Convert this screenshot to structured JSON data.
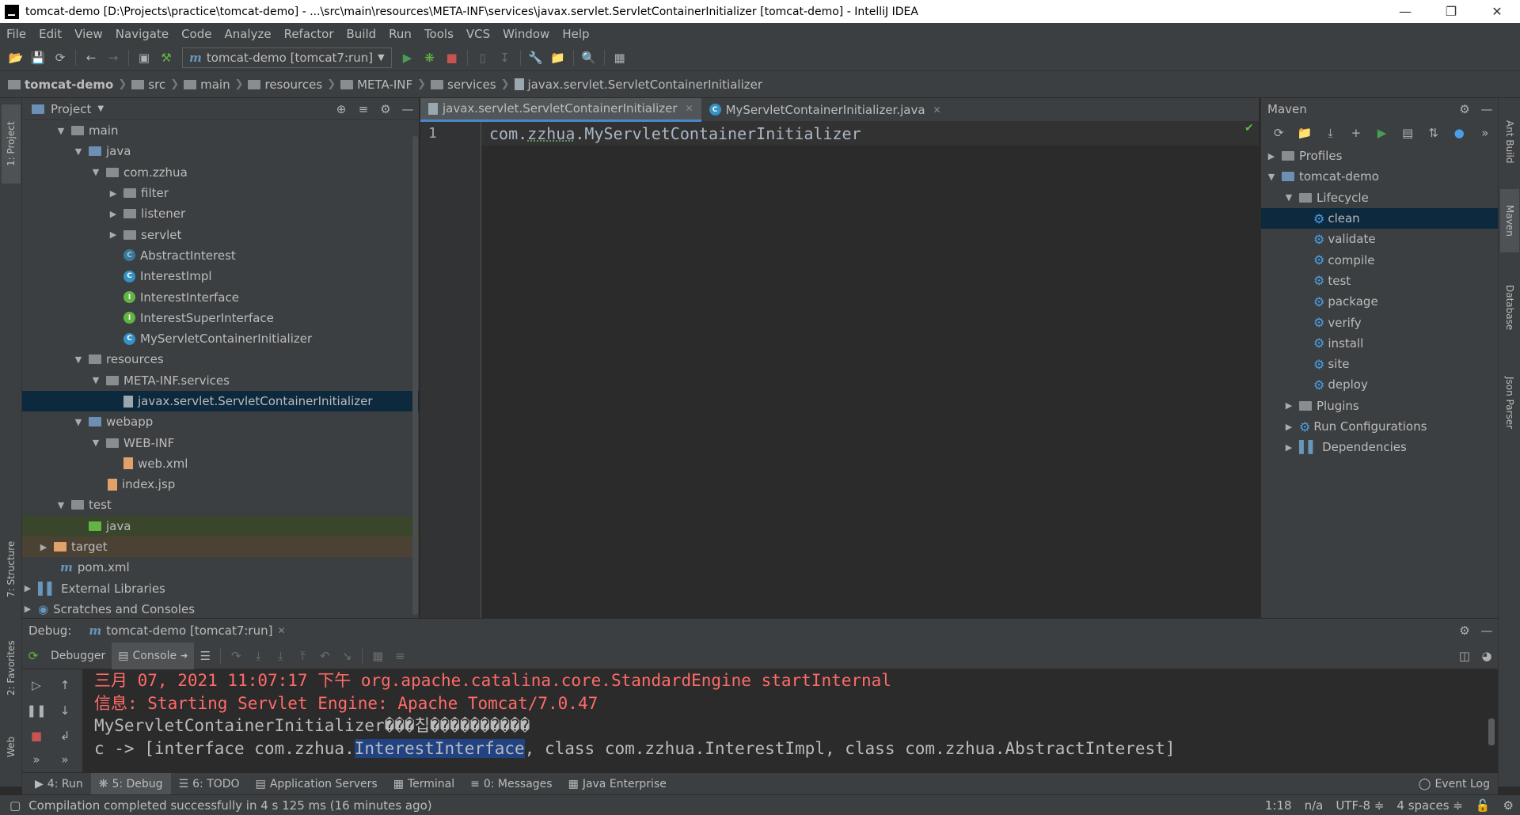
{
  "window": {
    "title": "tomcat-demo [D:\\Projects\\practice\\tomcat-demo] - ...\\src\\main\\resources\\META-INF\\services\\javax.servlet.ServletContainerInitializer [tomcat-demo] - IntelliJ IDEA"
  },
  "menu": [
    "File",
    "Edit",
    "View",
    "Navigate",
    "Code",
    "Analyze",
    "Refactor",
    "Build",
    "Run",
    "Tools",
    "VCS",
    "Window",
    "Help"
  ],
  "toolbar": {
    "run_config": "tomcat-demo [tomcat7:run]"
  },
  "breadcrumb": [
    "tomcat-demo",
    "src",
    "main",
    "resources",
    "META-INF",
    "services",
    "javax.servlet.ServletContainerInitializer"
  ],
  "left_strip": {
    "project": "1: Project",
    "structure": "7: Structure",
    "favorites": "2: Favorites",
    "web": "Web"
  },
  "right_strip": {
    "ant": "Ant Build",
    "maven": "Maven",
    "database": "Database",
    "json": "Json Parser"
  },
  "project": {
    "title": "Project",
    "tree": [
      {
        "label": "main"
      },
      {
        "label": "java"
      },
      {
        "label": "com.zzhua"
      },
      {
        "label": "filter"
      },
      {
        "label": "listener"
      },
      {
        "label": "servlet"
      },
      {
        "label": "AbstractInterest"
      },
      {
        "label": "InterestImpl"
      },
      {
        "label": "InterestInterface"
      },
      {
        "label": "InterestSuperInterface"
      },
      {
        "label": "MyServletContainerInitializer"
      },
      {
        "label": "resources"
      },
      {
        "label": "META-INF.services"
      },
      {
        "label": "javax.servlet.ServletContainerInitializer"
      },
      {
        "label": "webapp"
      },
      {
        "label": "WEB-INF"
      },
      {
        "label": "web.xml"
      },
      {
        "label": "index.jsp"
      },
      {
        "label": "test"
      },
      {
        "label": "java"
      },
      {
        "label": "target"
      },
      {
        "label": "pom.xml"
      },
      {
        "label": "External Libraries"
      },
      {
        "label": "Scratches and Consoles"
      }
    ]
  },
  "editor": {
    "tabs": [
      {
        "label": "javax.servlet.ServletContainerInitializer"
      },
      {
        "label": "MyServletContainerInitializer.java"
      }
    ],
    "line_number": "1",
    "code_pkg1": "com.",
    "code_pkg2": "zzhua",
    "code_rest": ".MyServletContainerInitializer"
  },
  "maven": {
    "title": "Maven",
    "tree": [
      {
        "label": "Profiles"
      },
      {
        "label": "tomcat-demo"
      },
      {
        "label": "Lifecycle"
      },
      {
        "label": "clean"
      },
      {
        "label": "validate"
      },
      {
        "label": "compile"
      },
      {
        "label": "test"
      },
      {
        "label": "package"
      },
      {
        "label": "verify"
      },
      {
        "label": "install"
      },
      {
        "label": "site"
      },
      {
        "label": "deploy"
      },
      {
        "label": "Plugins"
      },
      {
        "label": "Run Configurations"
      },
      {
        "label": "Dependencies"
      }
    ]
  },
  "debug": {
    "label": "Debug:",
    "session": "tomcat-demo [tomcat7:run]",
    "tab_debugger": "Debugger",
    "tab_console": "Console",
    "console": {
      "line1": "三月 07, 2021 11:07:17 下午 org.apache.catalina.core.StandardEngine startInternal",
      "line2": "信息: Starting Servlet Engine: Apache Tomcat/7.0.47",
      "line3": "MyServletContainerInitializer���칩����������",
      "line4a": "c -> [interface com.zzhua.",
      "line4b": "InterestInterface",
      "line4c": ", class com.zzhua.InterestImpl, class com.zzhua.AbstractInterest]"
    }
  },
  "bottom_tools": [
    {
      "label": "4: Run"
    },
    {
      "label": "5: Debug"
    },
    {
      "label": "6: TODO"
    },
    {
      "label": "Application Servers"
    },
    {
      "label": "Terminal"
    },
    {
      "label": "0: Messages"
    },
    {
      "label": "Java Enterprise"
    }
  ],
  "event_log": "Event Log",
  "status": {
    "message": "Compilation completed successfully in 4 s 125 ms (16 minutes ago)",
    "position": "1:18",
    "line_sep": "n/a",
    "encoding": "UTF-8 ≑",
    "indent": "4 spaces ≑"
  }
}
